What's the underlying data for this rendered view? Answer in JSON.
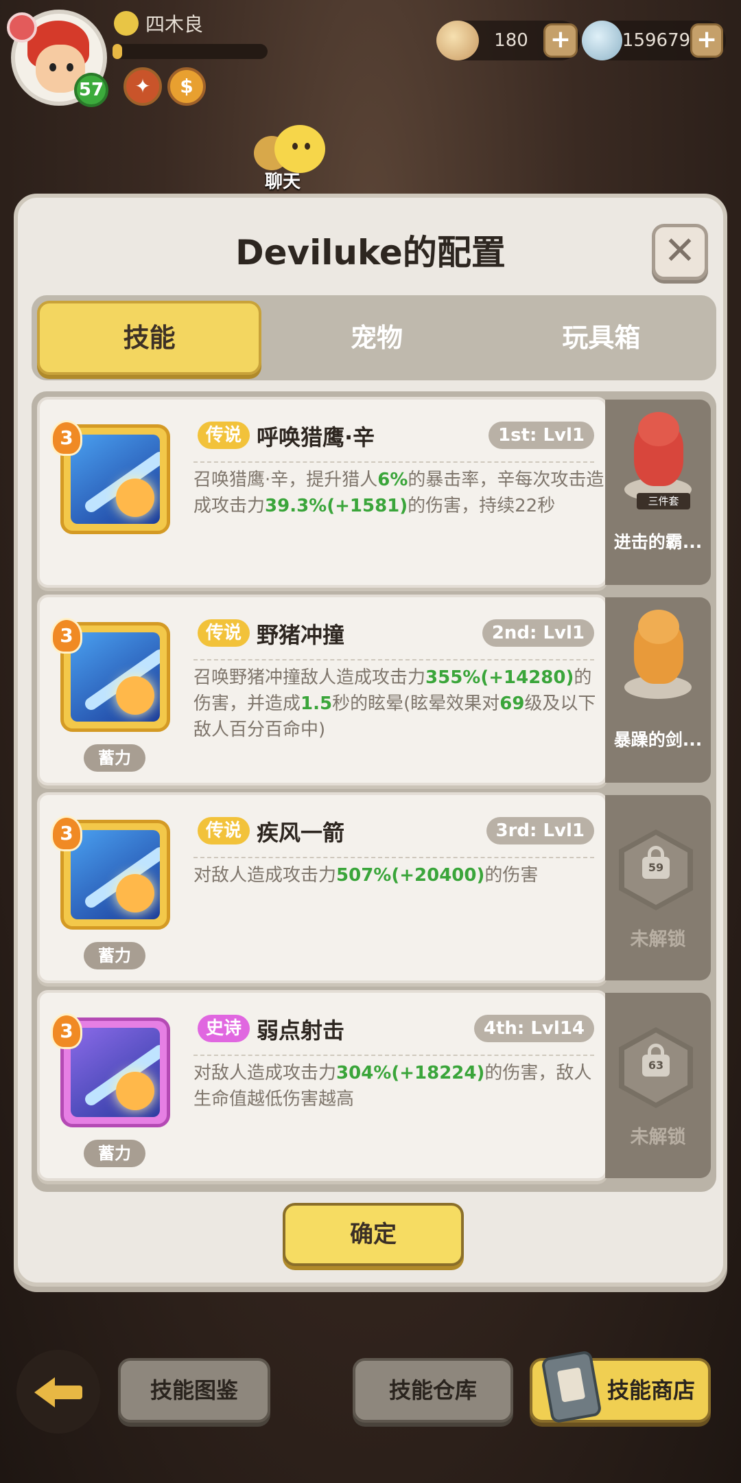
{
  "player": {
    "name": "四木良",
    "level": "57",
    "xp_fraction": 0.06
  },
  "currencies": [
    {
      "icon": "shell-icon",
      "value": "180"
    },
    {
      "icon": "gem-icon",
      "value": "159679"
    }
  ],
  "chat": {
    "label": "聊天"
  },
  "dialog": {
    "title": "Deviluke的配置",
    "tabs": [
      "技能",
      "宠物",
      "玩具箱"
    ],
    "active_tab": 0,
    "confirm_label": "确定"
  },
  "skills": [
    {
      "rank": "3",
      "rarity": "传说",
      "name": "呼唤猎鹰·辛",
      "slot": "1st: Lvl1",
      "desc_parts": [
        "召唤猎鹰·辛，提升猎人",
        "6%",
        "的暴击率，辛每次攻击造成攻击力",
        "39.3%(+1581)",
        "的伤害，持续22秒"
      ],
      "charge": ""
    },
    {
      "rank": "3",
      "rarity": "传说",
      "name": "野猪冲撞",
      "slot": "2nd: Lvl1",
      "desc_parts": [
        "召唤野猪冲撞敌人造成攻击力",
        "355%(+14280)",
        "的伤害，并造成",
        "1.5",
        "秒的眩晕(眩晕效果对",
        "69",
        "级及以下敌人百分百命中)"
      ],
      "charge": "蓄力"
    },
    {
      "rank": "3",
      "rarity": "传说",
      "name": "疾风一箭",
      "slot": "3rd: Lvl1",
      "desc_parts": [
        "对敌人造成攻击力",
        "507%(+20400)",
        "的伤害"
      ],
      "charge": "蓄力"
    },
    {
      "rank": "3",
      "rarity": "史诗",
      "name": "弱点射击",
      "slot": "4th: Lvl14",
      "desc_parts": [
        "对敌人造成攻击力",
        "304%(+18224)",
        "的伤害，敌人生命值越低伤害越高"
      ],
      "charge": "蓄力"
    }
  ],
  "side_slots": [
    {
      "type": "pet",
      "name": "进击的霸...",
      "set_tag": "三件套"
    },
    {
      "type": "pet",
      "name": "暴躁的剑..."
    },
    {
      "type": "locked",
      "level": "59",
      "label": "未解锁"
    },
    {
      "type": "locked",
      "level": "63",
      "label": "未解锁"
    }
  ],
  "bottom": {
    "codex": "技能图鉴",
    "storage": "技能仓库",
    "shop": "技能商店"
  },
  "colors": {
    "legend": "#f2c23a",
    "epic": "#e067e0",
    "highlight_green": "#3aa53a"
  }
}
